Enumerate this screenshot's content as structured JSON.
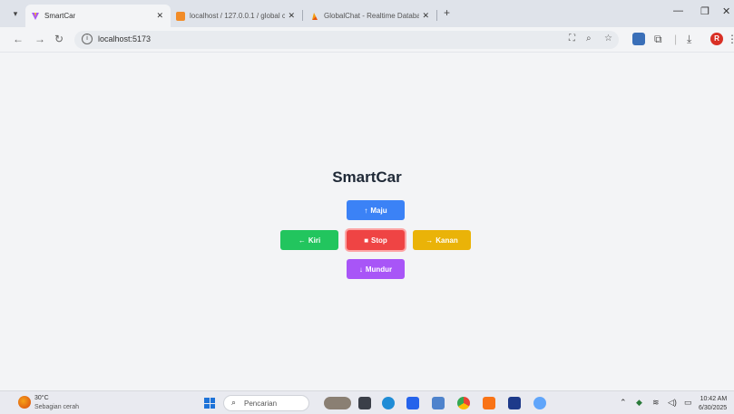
{
  "browser": {
    "tabs": [
      {
        "title": "SmartCar",
        "active": true
      },
      {
        "title": "localhost / 127.0.0.1 / global c",
        "active": false
      },
      {
        "title": "GlobalChat - Realtime Databas",
        "active": false
      }
    ],
    "address": "localhost:5173"
  },
  "app": {
    "title": "SmartCar",
    "controls": {
      "forward": {
        "icon": "↑",
        "label": "Maju",
        "color": "#3b82f6"
      },
      "left": {
        "icon": "←",
        "label": "Kiri",
        "color": "#22c55e"
      },
      "stop": {
        "icon": "■",
        "label": "Stop",
        "color": "#ef4444"
      },
      "right": {
        "icon": "→",
        "label": "Kanan",
        "color": "#eab308"
      },
      "backward": {
        "icon": "↓",
        "label": "Mundur",
        "color": "#a855f7"
      }
    }
  },
  "taskbar": {
    "weather_temp": "30°C",
    "weather_condition": "Sebagian cerah",
    "search_placeholder": "Pencarian",
    "time": "10:42 AM",
    "date": "6/30/2025"
  }
}
